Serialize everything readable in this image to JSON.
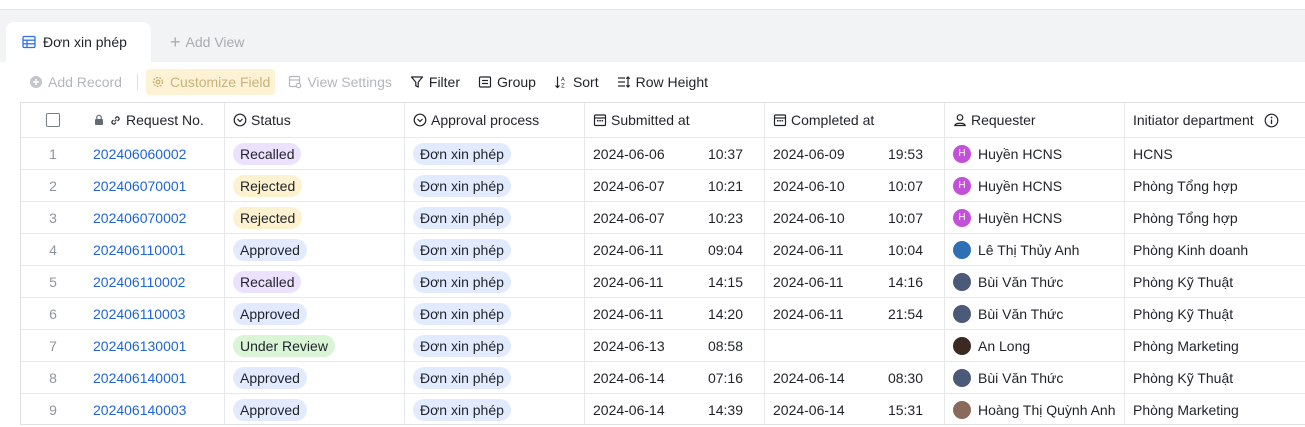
{
  "tabs": {
    "active_label": "Đơn xin phép",
    "add_label": "Add View"
  },
  "toolbar": {
    "add_record": "Add Record",
    "customize_field": "Customize Field",
    "view_settings": "View Settings",
    "filter": "Filter",
    "group": "Group",
    "sort": "Sort",
    "row_height": "Row Height"
  },
  "columns": {
    "request_no": "Request No.",
    "status": "Status",
    "approval": "Approval process",
    "submitted": "Submitted at",
    "completed": "Completed at",
    "requester": "Requester",
    "department": "Initiator department"
  },
  "status_colors": {
    "Recalled": "#ece2fe",
    "Rejected": "#fdf2cf",
    "Approved": "#e1eaff",
    "Under Review": "#d9f5d6"
  },
  "rows": [
    {
      "num": "1",
      "request_no": "202406060002",
      "status": "Recalled",
      "approval": "Đơn xin phép",
      "sub_date": "2024-06-06",
      "sub_time": "10:37",
      "comp_date": "2024-06-09",
      "comp_time": "19:53",
      "requester": "Huyền HCNS",
      "avatar": "H",
      "avatar_color": "#c250d8",
      "department": "HCNS"
    },
    {
      "num": "2",
      "request_no": "202406070001",
      "status": "Rejected",
      "approval": "Đơn xin phép",
      "sub_date": "2024-06-07",
      "sub_time": "10:21",
      "comp_date": "2024-06-10",
      "comp_time": "10:07",
      "requester": "Huyền HCNS",
      "avatar": "H",
      "avatar_color": "#c250d8",
      "department": "Phòng Tổng hợp"
    },
    {
      "num": "3",
      "request_no": "202406070002",
      "status": "Rejected",
      "approval": "Đơn xin phép",
      "sub_date": "2024-06-07",
      "sub_time": "10:23",
      "comp_date": "2024-06-10",
      "comp_time": "10:07",
      "requester": "Huyền HCNS",
      "avatar": "H",
      "avatar_color": "#c250d8",
      "department": "Phòng Tổng hợp"
    },
    {
      "num": "4",
      "request_no": "202406110001",
      "status": "Approved",
      "approval": "Đơn xin phép",
      "sub_date": "2024-06-11",
      "sub_time": "09:04",
      "comp_date": "2024-06-11",
      "comp_time": "10:04",
      "requester": "Lê Thị Thủy Anh",
      "avatar": "",
      "avatar_color": "#2f6fb5",
      "department": "Phòng Kinh doanh"
    },
    {
      "num": "5",
      "request_no": "202406110002",
      "status": "Recalled",
      "approval": "Đơn xin phép",
      "sub_date": "2024-06-11",
      "sub_time": "14:15",
      "comp_date": "2024-06-11",
      "comp_time": "14:16",
      "requester": "Bùi Văn Thức",
      "avatar": "",
      "avatar_color": "#4a5a78",
      "department": "Phòng Kỹ Thuật"
    },
    {
      "num": "6",
      "request_no": "202406110003",
      "status": "Approved",
      "approval": "Đơn xin phép",
      "sub_date": "2024-06-11",
      "sub_time": "14:20",
      "comp_date": "2024-06-11",
      "comp_time": "21:54",
      "requester": "Bùi Văn Thức",
      "avatar": "",
      "avatar_color": "#4a5a78",
      "department": "Phòng Kỹ Thuật"
    },
    {
      "num": "7",
      "request_no": "202406130001",
      "status": "Under Review",
      "approval": "Đơn xin phép",
      "sub_date": "2024-06-13",
      "sub_time": "08:58",
      "comp_date": "",
      "comp_time": "",
      "requester": "An Long",
      "avatar": "",
      "avatar_color": "#3a2a22",
      "department": "Phòng Marketing"
    },
    {
      "num": "8",
      "request_no": "202406140001",
      "status": "Approved",
      "approval": "Đơn xin phép",
      "sub_date": "2024-06-14",
      "sub_time": "07:16",
      "comp_date": "2024-06-14",
      "comp_time": "08:30",
      "requester": "Bùi Văn Thức",
      "avatar": "",
      "avatar_color": "#4a5a78",
      "department": "Phòng Kỹ Thuật"
    },
    {
      "num": "9",
      "request_no": "202406140003",
      "status": "Approved",
      "approval": "Đơn xin phép",
      "sub_date": "2024-06-14",
      "sub_time": "14:39",
      "comp_date": "2024-06-14",
      "comp_time": "15:31",
      "requester": "Hoàng Thị Quỳnh Anh",
      "avatar": "",
      "avatar_color": "#8a6a5a",
      "department": "Phòng Marketing"
    }
  ]
}
